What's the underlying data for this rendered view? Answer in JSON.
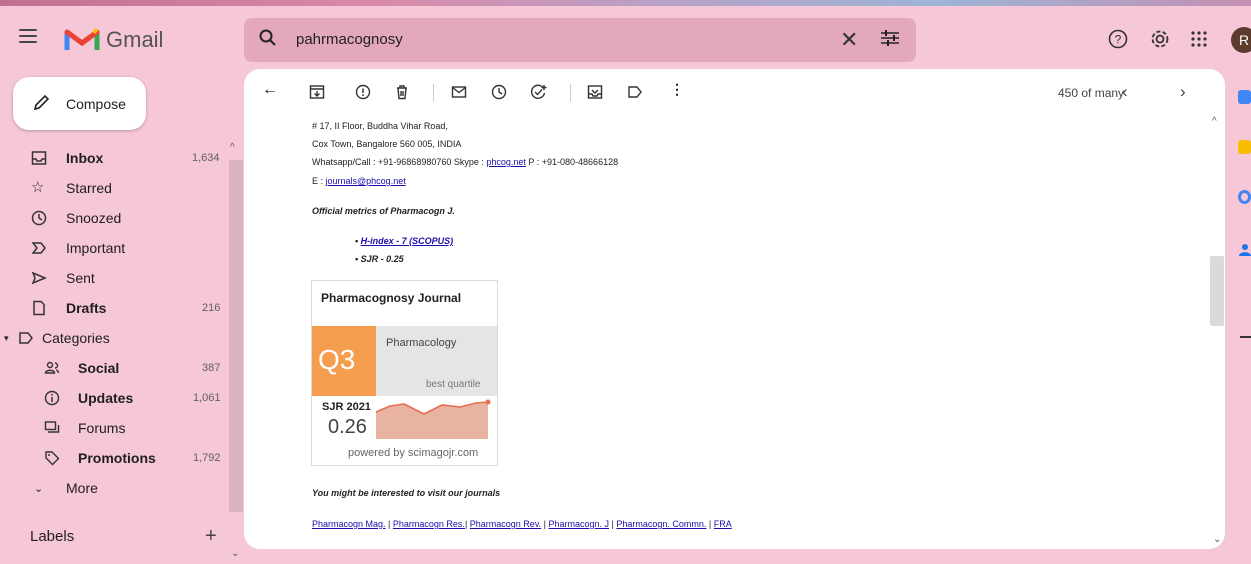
{
  "app": {
    "name": "Gmail",
    "avatar_initial": "R"
  },
  "search": {
    "query": "pahrmacognosy"
  },
  "compose": {
    "label": "Compose"
  },
  "sidebar": {
    "items": [
      {
        "label": "Inbox",
        "count": "1,634",
        "bold": true
      },
      {
        "label": "Starred",
        "count": ""
      },
      {
        "label": "Snoozed",
        "count": ""
      },
      {
        "label": "Important",
        "count": ""
      },
      {
        "label": "Sent",
        "count": ""
      },
      {
        "label": "Drafts",
        "count": "216",
        "bold": true
      },
      {
        "label": "Categories",
        "count": ""
      },
      {
        "label": "Social",
        "count": "387",
        "bold": true
      },
      {
        "label": "Updates",
        "count": "1,061",
        "bold": true
      },
      {
        "label": "Forums",
        "count": ""
      },
      {
        "label": "Promotions",
        "count": "1,792",
        "bold": true
      },
      {
        "label": "More",
        "count": ""
      }
    ],
    "labels_title": "Labels",
    "labels_add": "+"
  },
  "toolbar": {
    "pager": "450 of many"
  },
  "email": {
    "address_line1": "# 17, II Floor, Buddha Vihar Road,",
    "address_line2": "Cox Town, Bangalore 560 005, INDIA",
    "contact_prefix": "Whatsapp/Call : +91-96868980760 Skype : ",
    "skype": "phcog.net",
    "contact_suffix": " P : +91-080-48666128",
    "email_prefix": "E : ",
    "email": "journals@phcog.net",
    "metrics_heading": "Official metrics of Pharmacogn J.",
    "metric_1": "H-index - 7 (SCOPUS)",
    "metric_2": "SJR - 0.25",
    "interest_heading": "You might be interested to visit our journals",
    "journal_links": [
      "Pharmacogn Mag.",
      "Pharmacogn Res.",
      "Pharmacogn Rev.",
      "Pharmacogn. J",
      "Pharmacogn. Commn.",
      "FRA"
    ]
  },
  "badge": {
    "title": "Pharmacognosy Journal",
    "quartile": "Q3",
    "category": "Pharmacology",
    "best_quartile_label": "best quartile",
    "sjr_label": "SJR 2021",
    "sjr_value": "0.26",
    "powered_by": "powered by scimagojr.com",
    "accent_color": "#f59e50",
    "spark_color": "#e76f51"
  }
}
